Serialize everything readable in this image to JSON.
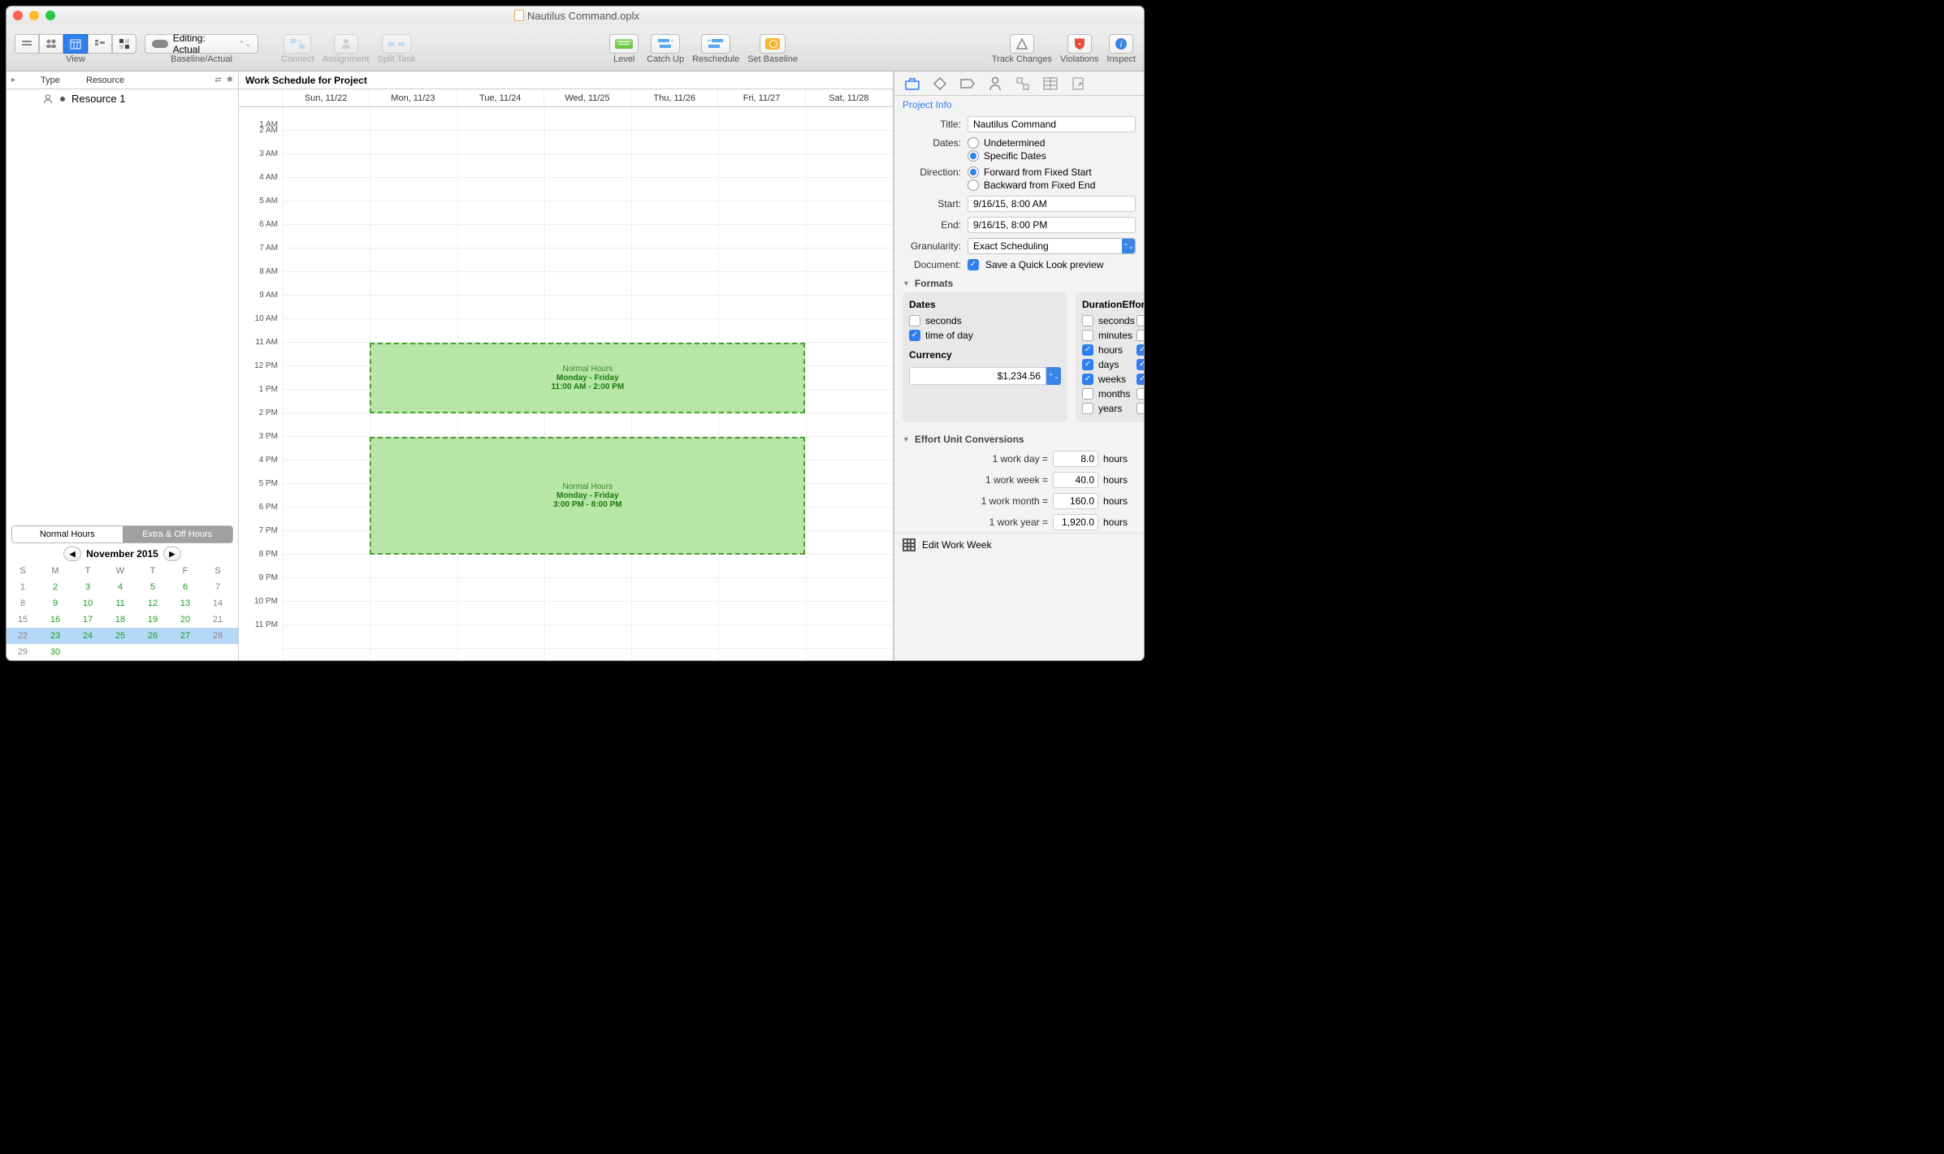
{
  "window": {
    "title": "Nautilus Command.oplx"
  },
  "toolbar": {
    "view_label": "View",
    "baseline_label": "Baseline/Actual",
    "editing_label": "Editing: Actual",
    "connect": "Connect",
    "assignment": "Assignment",
    "split_task": "Split Task",
    "level": "Level",
    "catch_up": "Catch Up",
    "reschedule": "Reschedule",
    "set_baseline": "Set Baseline",
    "track_changes": "Track Changes",
    "violations": "Violations",
    "inspect": "Inspect"
  },
  "left": {
    "type_header": "Type",
    "resource_header": "Resource",
    "resource_1": "Resource 1",
    "tab_normal": "Normal Hours",
    "tab_extra": "Extra & Off Hours",
    "month": "November 2015",
    "dow": [
      "S",
      "M",
      "T",
      "W",
      "T",
      "F",
      "S"
    ],
    "weeks": [
      [
        "1",
        "2",
        "3",
        "4",
        "5",
        "6",
        "7"
      ],
      [
        "8",
        "9",
        "10",
        "11",
        "12",
        "13",
        "14"
      ],
      [
        "15",
        "16",
        "17",
        "18",
        "19",
        "20",
        "21"
      ],
      [
        "22",
        "23",
        "24",
        "25",
        "26",
        "27",
        "28"
      ],
      [
        "29",
        "30",
        "",
        "",
        "",
        "",
        ""
      ]
    ]
  },
  "schedule": {
    "title": "Work Schedule for Project",
    "days": [
      "Sun, 11/22",
      "Mon, 11/23",
      "Tue, 11/24",
      "Wed, 11/25",
      "Thu, 11/26",
      "Fri, 11/27",
      "Sat, 11/28"
    ],
    "hours": [
      "1 AM",
      "2 AM",
      "3 AM",
      "4 AM",
      "5 AM",
      "6 AM",
      "7 AM",
      "8 AM",
      "9 AM",
      "10 AM",
      "11 AM",
      "12 PM",
      "1 PM",
      "2 PM",
      "3 PM",
      "4 PM",
      "5 PM",
      "6 PM",
      "7 PM",
      "8 PM",
      "9 PM",
      "10 PM",
      "11 PM"
    ],
    "block1": {
      "title": "Normal Hours",
      "sub": "Monday - Friday",
      "time": "11:00 AM - 2:00 PM"
    },
    "block2": {
      "title": "Normal Hours",
      "sub": "Monday - Friday",
      "time": "3:00 PM - 8:00 PM"
    }
  },
  "inspector": {
    "header": "Project Info",
    "title_label": "Title:",
    "title_value": "Nautilus Command",
    "dates_label": "Dates:",
    "dates_undetermined": "Undetermined",
    "dates_specific": "Specific Dates",
    "direction_label": "Direction:",
    "dir_forward": "Forward from Fixed Start",
    "dir_backward": "Backward from Fixed End",
    "start_label": "Start:",
    "start_value": "9/16/15, 8:00 AM",
    "end_label": "End:",
    "end_value": "9/16/15, 8:00 PM",
    "gran_label": "Granularity:",
    "gran_value": "Exact Scheduling",
    "doc_label": "Document:",
    "doc_check": "Save a Quick Look preview",
    "formats_header": "Formats",
    "dates_head": "Dates",
    "seconds": "seconds",
    "time_of_day": "time of day",
    "currency_head": "Currency",
    "currency_value": "$1,234.56",
    "duration_head": "Duration",
    "effort_head": "Effort",
    "minutes": "minutes",
    "hours": "hours",
    "days": "days",
    "weeks": "weeks",
    "months": "months",
    "years": "years",
    "conv_header": "Effort Unit Conversions",
    "conv_day_lbl": "1 work day =",
    "conv_day_val": "8.0",
    "conv_week_lbl": "1 work week =",
    "conv_week_val": "40.0",
    "conv_month_lbl": "1 work month =",
    "conv_month_val": "160.0",
    "conv_year_lbl": "1 work year =",
    "conv_year_val": "1,920.0",
    "hours_unit": "hours",
    "edit_ww": "Edit Work Week"
  }
}
